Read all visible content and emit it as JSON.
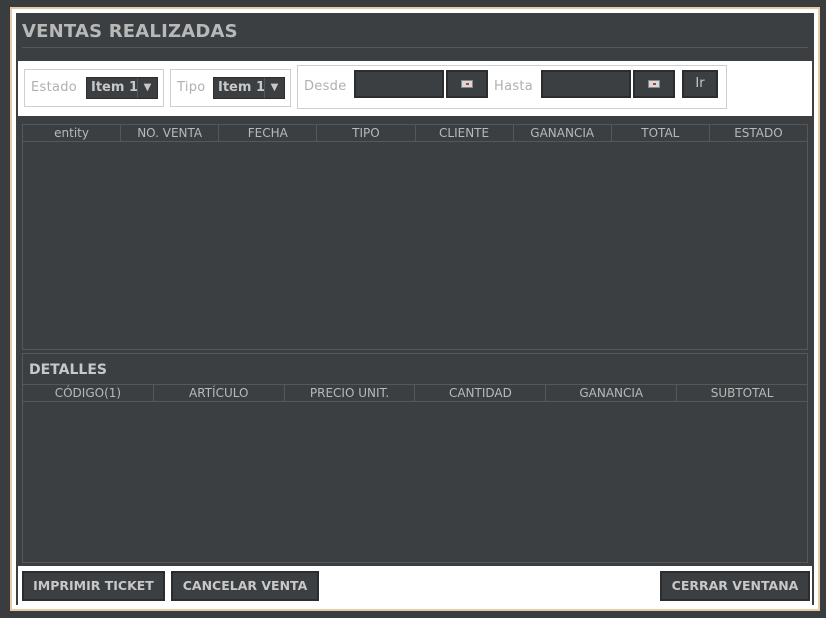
{
  "window": {
    "title": "VENTAS REALIZADAS"
  },
  "filters": {
    "estado": {
      "label": "Estado",
      "value": "Item 1"
    },
    "tipo": {
      "label": "Tipo",
      "value": "Item 1"
    },
    "desde": {
      "label": "Desde",
      "value": ""
    },
    "hasta": {
      "label": "Hasta",
      "value": ""
    },
    "go_label": "Ir"
  },
  "sales_table": {
    "columns": [
      "entity",
      "NO. VENTA",
      "FECHA",
      "TIPO",
      "CLIENTE",
      "GANANCIA",
      "TOTAL",
      "ESTADO"
    ]
  },
  "details": {
    "title": "DETALLES",
    "columns": [
      "CÓDIGO(1)",
      "ARTÍCULO",
      "PRECIO UNIT.",
      "CANTIDAD",
      "GANANCIA",
      "SUBTOTAL"
    ]
  },
  "actions": {
    "print": "IMPRIMIR TICKET",
    "cancel": "CANCELAR VENTA",
    "close": "CERRAR VENTANA"
  },
  "icons": {
    "dropdown": "chevron-down-icon",
    "calendar": "calendar-icon"
  }
}
